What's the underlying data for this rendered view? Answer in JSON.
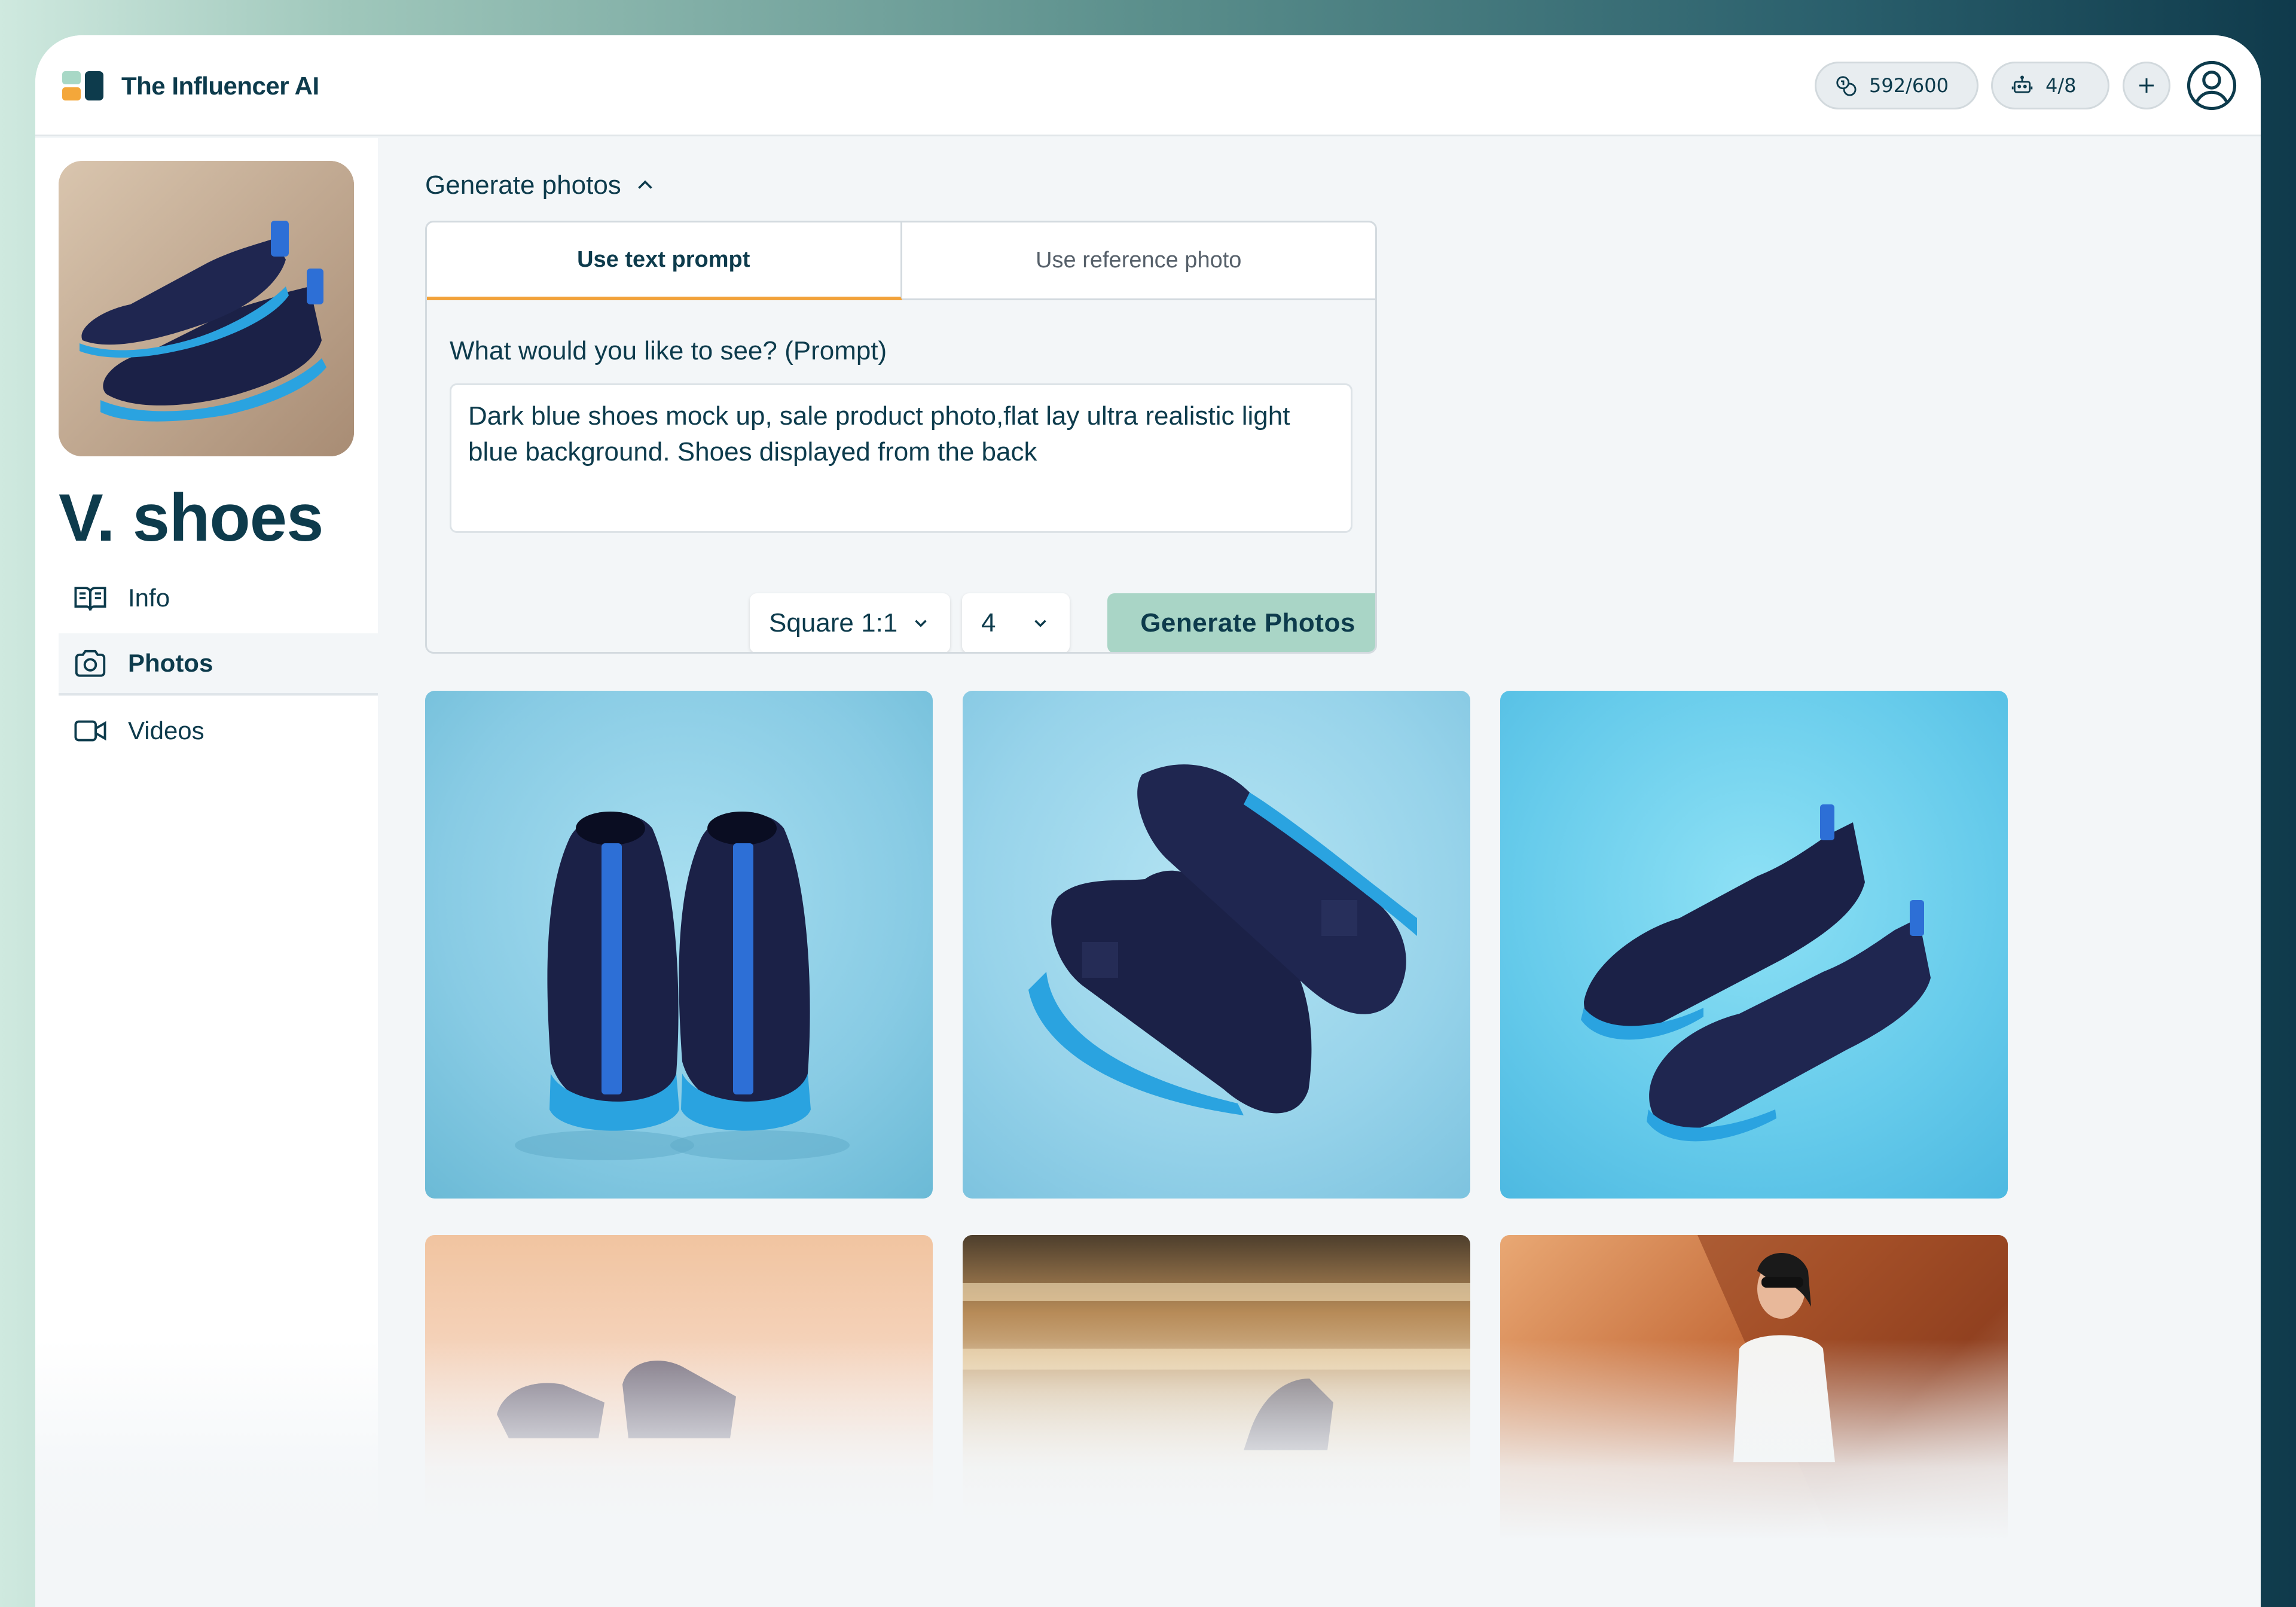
{
  "app": {
    "name": "The Influencer AI"
  },
  "header": {
    "credits": "592/600",
    "bots": "4/8"
  },
  "sidebar": {
    "title": "V. shoes",
    "items": [
      {
        "label": "Info",
        "icon": "book-icon"
      },
      {
        "label": "Photos",
        "icon": "camera-icon",
        "active": true
      },
      {
        "label": "Videos",
        "icon": "video-icon"
      }
    ]
  },
  "generate": {
    "section_label": "Generate photos",
    "tabs": [
      "Use text prompt",
      "Use reference photo"
    ],
    "prompt_label": "What would you like to see? (Prompt)",
    "prompt_value": "Dark blue shoes mock up, sale product photo,flat lay ultra realistic light blue background. Shoes displayed from the back",
    "ratio": "Square 1:1",
    "count": "4",
    "button": "Generate Photos"
  },
  "colors": {
    "brand_dark": "#0d3b4c",
    "accent_orange": "#f2a23a",
    "mint": "#a9d5c6",
    "background": "#f3f6f8"
  }
}
